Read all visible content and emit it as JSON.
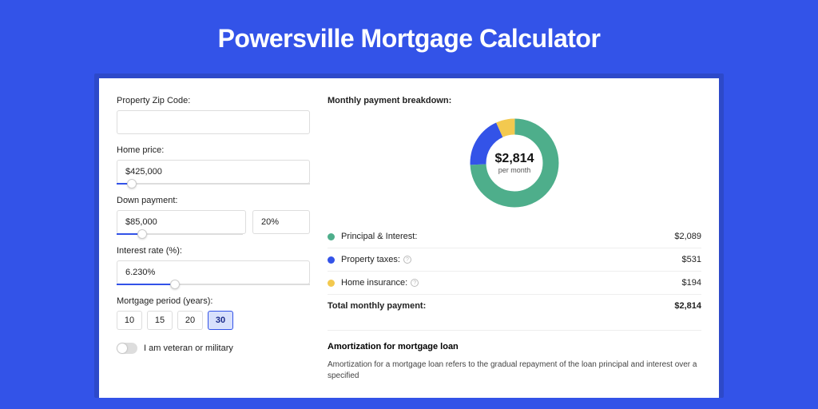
{
  "title": "Powersville Mortgage Calculator",
  "form": {
    "zip_label": "Property Zip Code:",
    "zip_value": "",
    "home_price_label": "Home price:",
    "home_price_value": "$425,000",
    "home_price_slider_pct": 8,
    "down_payment_label": "Down payment:",
    "down_payment_value": "$85,000",
    "down_payment_pct_value": "20%",
    "down_payment_slider_pct": 20,
    "interest_label": "Interest rate (%):",
    "interest_value": "6.230%",
    "interest_slider_pct": 30,
    "period_label": "Mortgage period (years):",
    "periods": [
      "10",
      "15",
      "20",
      "30"
    ],
    "period_selected": "30",
    "veteran_label": "I am veteran or military"
  },
  "breakdown": {
    "title": "Monthly payment breakdown:",
    "center_amount": "$2,814",
    "center_sub": "per month",
    "items": [
      {
        "label": "Principal & Interest:",
        "value": "$2,089",
        "color": "#4eae8b",
        "info": false
      },
      {
        "label": "Property taxes:",
        "value": "$531",
        "color": "#3353e8",
        "info": true
      },
      {
        "label": "Home insurance:",
        "value": "$194",
        "color": "#f3c94f",
        "info": true
      }
    ],
    "total_label": "Total monthly payment:",
    "total_value": "$2,814"
  },
  "chart_data": {
    "type": "pie",
    "title": "Monthly payment breakdown",
    "series": [
      {
        "name": "Principal & Interest",
        "value": 2089,
        "color": "#4eae8b"
      },
      {
        "name": "Property taxes",
        "value": 531,
        "color": "#3353e8"
      },
      {
        "name": "Home insurance",
        "value": 194,
        "color": "#f3c94f"
      }
    ],
    "total": 2814
  },
  "amortization": {
    "title": "Amortization for mortgage loan",
    "text": "Amortization for a mortgage loan refers to the gradual repayment of the loan principal and interest over a specified"
  }
}
